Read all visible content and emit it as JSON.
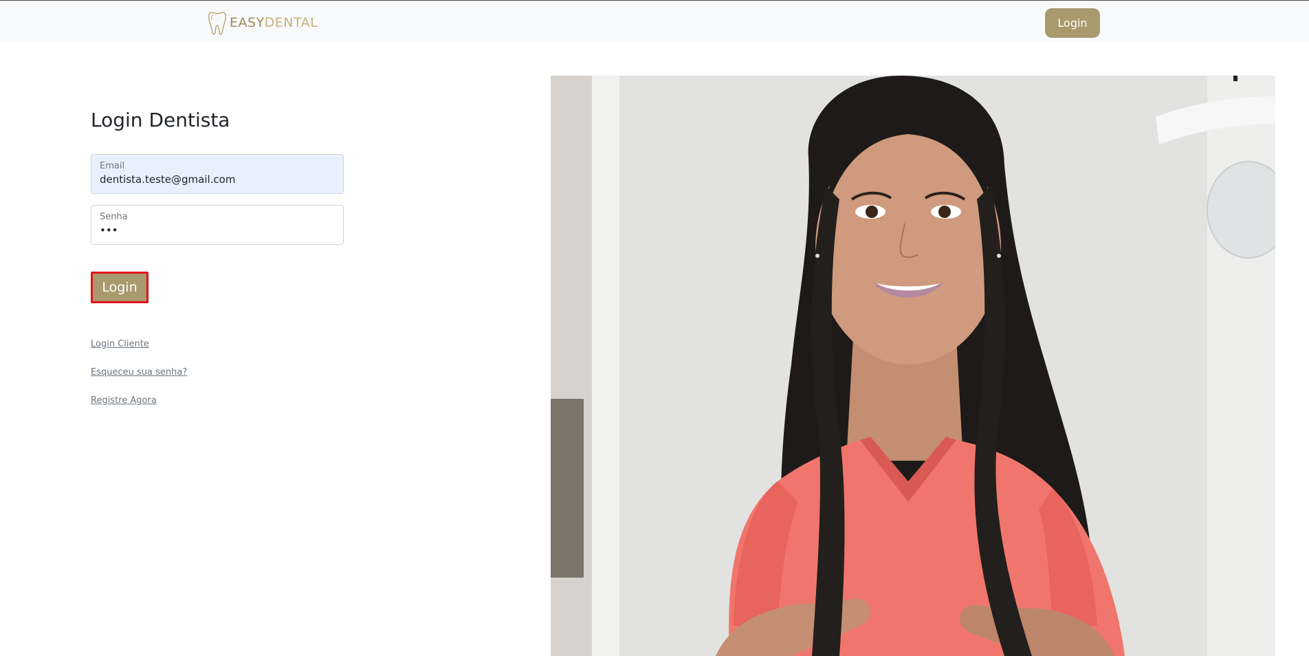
{
  "header": {
    "brand": {
      "part1": "EASY",
      "part2": "DENTAL",
      "icon": "tooth-icon"
    },
    "login_label": "Login"
  },
  "form": {
    "title": "Login Dentista",
    "email": {
      "label": "Email",
      "value": "dentista.teste@gmail.com"
    },
    "password": {
      "label": "Senha",
      "value": "•••"
    },
    "submit_label": "Login"
  },
  "links": {
    "client_login": "Login Cliente",
    "forgot_password": "Esqueceu sua senha?",
    "register": "Registre Agora"
  },
  "colors": {
    "brand_gold": "#a89a6c",
    "highlight_border": "#e3121b",
    "autofill_bg": "#e8f0fe"
  }
}
